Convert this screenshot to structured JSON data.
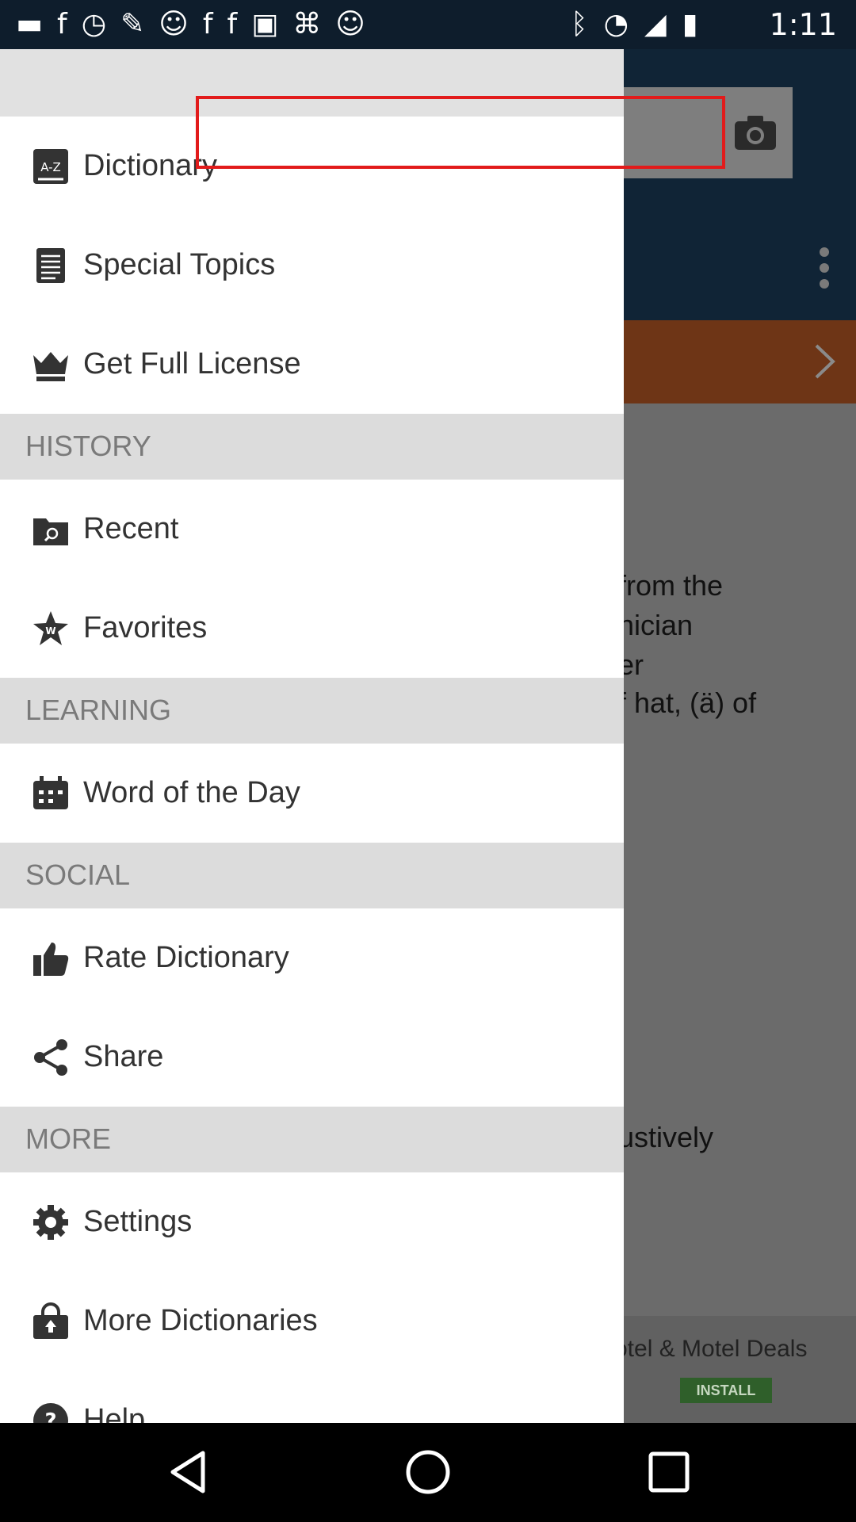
{
  "status_bar": {
    "time": "1:11"
  },
  "background": {
    "content_lines": [
      "from the",
      "nician",
      "er",
      "f hat, (ä) of"
    ],
    "content_line_later": "ustively",
    "ad": {
      "title": "otel & Motel Deals",
      "install": "INSTALL"
    }
  },
  "drawer": {
    "items_top": [
      {
        "label": "Dictionary",
        "icon": "a-z-book-icon"
      },
      {
        "label": "Special Topics",
        "icon": "document-icon"
      },
      {
        "label": "Get Full License",
        "icon": "crown-icon"
      }
    ],
    "sections": [
      {
        "header": "HISTORY",
        "items": [
          {
            "label": "Recent",
            "icon": "folder-search-icon"
          },
          {
            "label": "Favorites",
            "icon": "star-w-icon"
          }
        ]
      },
      {
        "header": "LEARNING",
        "items": [
          {
            "label": "Word of the Day",
            "icon": "calendar-icon"
          }
        ]
      },
      {
        "header": "SOCIAL",
        "items": [
          {
            "label": "Rate Dictionary",
            "icon": "thumbs-up-icon"
          },
          {
            "label": "Share",
            "icon": "share-icon"
          }
        ]
      },
      {
        "header": "MORE",
        "items": [
          {
            "label": "Settings",
            "icon": "gear-icon"
          },
          {
            "label": "More Dictionaries",
            "icon": "shopping-bag-icon"
          },
          {
            "label": "Help",
            "icon": "help-icon"
          }
        ]
      }
    ]
  },
  "colors": {
    "drawer_bg": "#ffffff",
    "section_bg": "#dcdcdc",
    "highlight": "#e21b1b",
    "toolbar": "#102436",
    "banner": "#6e3516"
  }
}
